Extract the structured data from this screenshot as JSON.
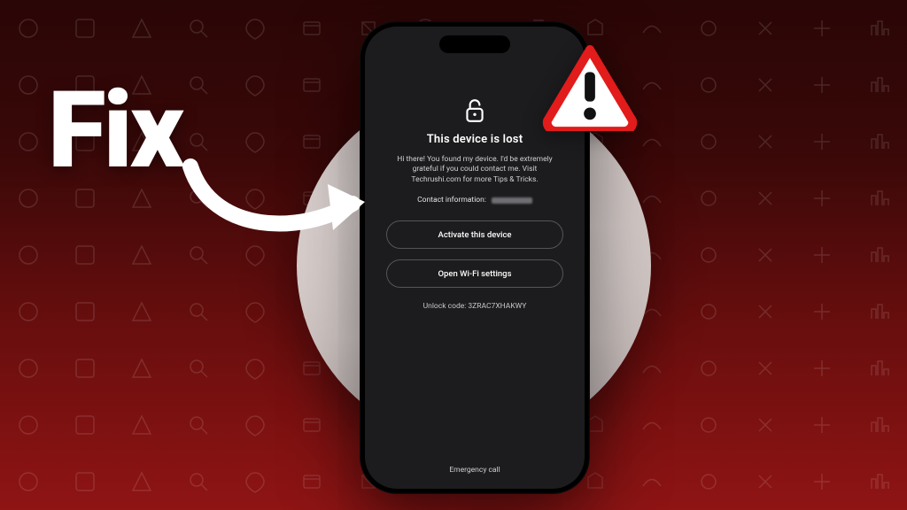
{
  "overlay": {
    "fix": "Fix"
  },
  "phone": {
    "title": "This device is lost",
    "message": "Hi there! You found my device. I'd be extremely grateful if you could contact me. Visit Techrushi.com for more Tips & Tricks.",
    "contact_label": "Contact information:",
    "activate": "Activate this device",
    "wifi": "Open Wi-Fi settings",
    "unlock_code": "Unlock code: 3ZRAC7XHAKWY",
    "emergency": "Emergency call"
  }
}
